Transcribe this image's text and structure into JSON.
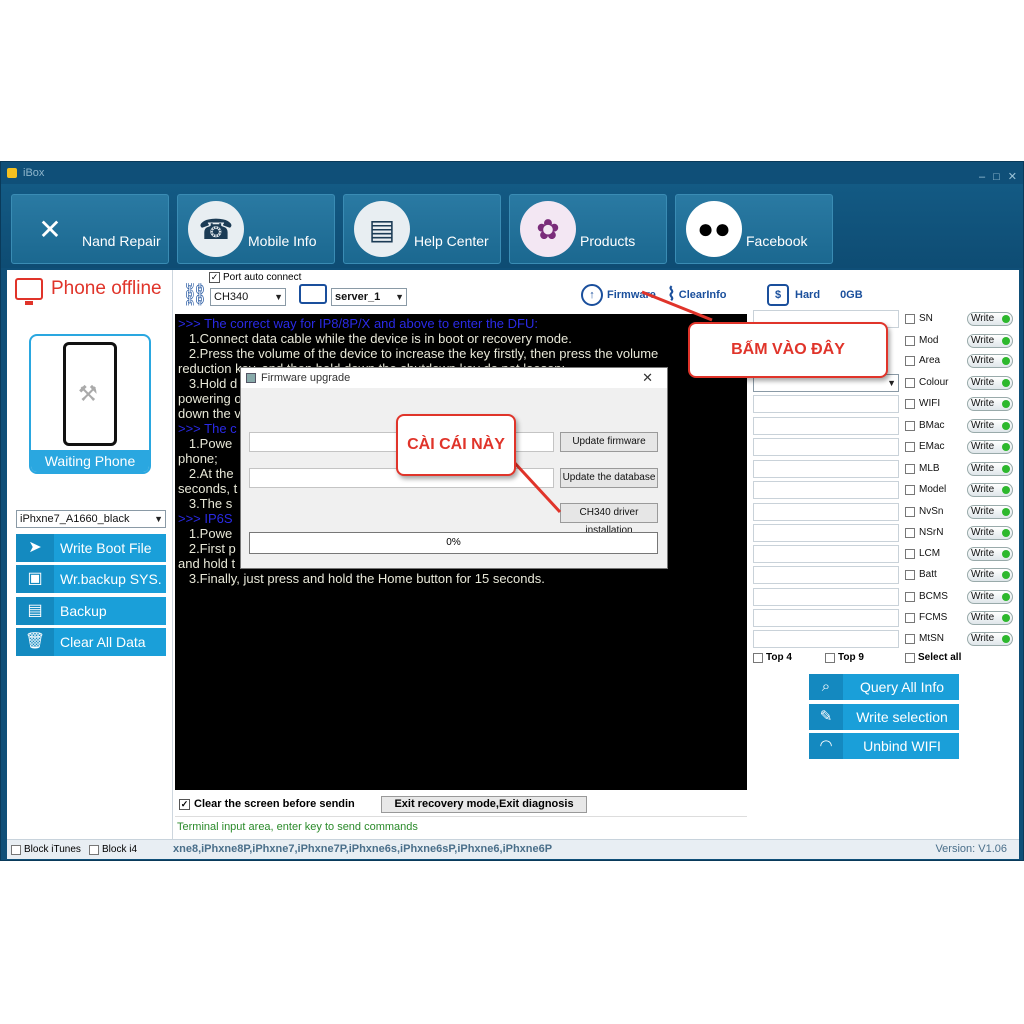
{
  "window": {
    "title": "iBox",
    "controls": [
      "‒",
      "□",
      "✕"
    ]
  },
  "nav": [
    {
      "label": "Nand Repair",
      "icon": "repair-tool-icon"
    },
    {
      "label": "Mobile Info",
      "icon": "phone-hand-icon"
    },
    {
      "label": "Help Center",
      "icon": "help-book-icon"
    },
    {
      "label": "Products",
      "icon": "products-icon"
    },
    {
      "label": "Facebook",
      "icon": "group-icon"
    }
  ],
  "left": {
    "status": "Phone offline",
    "card_caption": "Waiting Phone",
    "model_select": "iPhxne7_A1660_black",
    "buttons": [
      "Write Boot File",
      "Wr.backup SYS.",
      "Backup SYSCFG",
      "Clear All Data"
    ]
  },
  "toolbar": {
    "port_auto_connect": "Port auto connect",
    "port_select": "CH340",
    "server_select": "server_1",
    "firmware": "Firmware",
    "clearinfo": "ClearInfo",
    "hard": "Hard",
    "hard_value": "0GB"
  },
  "console": {
    "lines": [
      {
        "c": "b",
        "t": ">>> The correct way for IP8/8P/X and above to enter the DFU:"
      },
      {
        "c": "w",
        "t": "   1.Connect data cable while the device is in boot or recovery mode."
      },
      {
        "c": "w",
        "t": "   2.Press the volume of the device to increase the key firstly, then press the volume"
      },
      {
        "c": "w",
        "t": "reduction key, and then hold down the shutdown key do not loosen;"
      },
      {
        "c": "w",
        "t": "   3.Hold d                                                                        le when"
      },
      {
        "c": "w",
        "t": "powering o                                                                       and hold"
      },
      {
        "c": "w",
        "t": "down the v                                                                    uccessfully."
      },
      {
        "c": "b",
        "t": ">>> The c"
      },
      {
        "c": "w",
        "t": "   1.Powe                                                                        off the"
      },
      {
        "c": "w",
        "t": "phone;"
      },
      {
        "c": "w",
        "t": "   2.At the                                                                       for 10"
      },
      {
        "c": "w",
        "t": "seconds, t                                                                      seconds."
      },
      {
        "c": "w",
        "t": "   3.The s"
      },
      {
        "c": "b",
        "t": ">>> IP6S"
      },
      {
        "c": "w",
        "t": "   1.Powe"
      },
      {
        "c": "w",
        "t": "   2.First p                                                                    sly press"
      },
      {
        "c": "w",
        "t": "and hold t"
      },
      {
        "c": "w",
        "t": "   3.Finally, just press and hold the Home button for 15 seconds."
      }
    ]
  },
  "below": {
    "clear_screen": "Clear the screen before sendin",
    "exit_button": "Exit recovery mode,Exit diagnosis",
    "terminal_hint": "Terminal input area, enter key to send commands"
  },
  "right": {
    "items": [
      "SN",
      "Mod",
      "Area",
      "Colour",
      "WIFI",
      "BMac",
      "EMac",
      "MLB",
      "Model",
      "NvSn",
      "NSrN",
      "LCM",
      "Batt",
      "BCMS",
      "FCMS",
      "MtSN"
    ],
    "write_label": "Write",
    "top4": "Top 4",
    "top9": "Top 9",
    "select_all": "Select all",
    "buttons": [
      "Query All Info",
      "Write selection",
      "Unbind WIFI"
    ]
  },
  "dialog": {
    "title": "Firmware upgrade",
    "close": "✕",
    "update_firmware": "Update firmware",
    "update_database": "Update the database",
    "ch340": "CH340 driver installation",
    "progress": "0%"
  },
  "status": {
    "block_itunes": "Block iTunes",
    "block_i4": "Block i4",
    "models": "xne8,iPhxne8P,iPhxne7,iPhxne7P,iPhxne6s,iPhxne6sP,iPhxne6,iPhxne6P",
    "version": "Version: V1.06"
  },
  "callouts": {
    "firmware_hint": "BẤM VÀO ĐÂY",
    "driver_hint": "CÀI CÁI NÀY"
  },
  "colors": {
    "accent": "#1a9fd9",
    "callout": "#e0342a",
    "frame": "#0f4f78"
  }
}
